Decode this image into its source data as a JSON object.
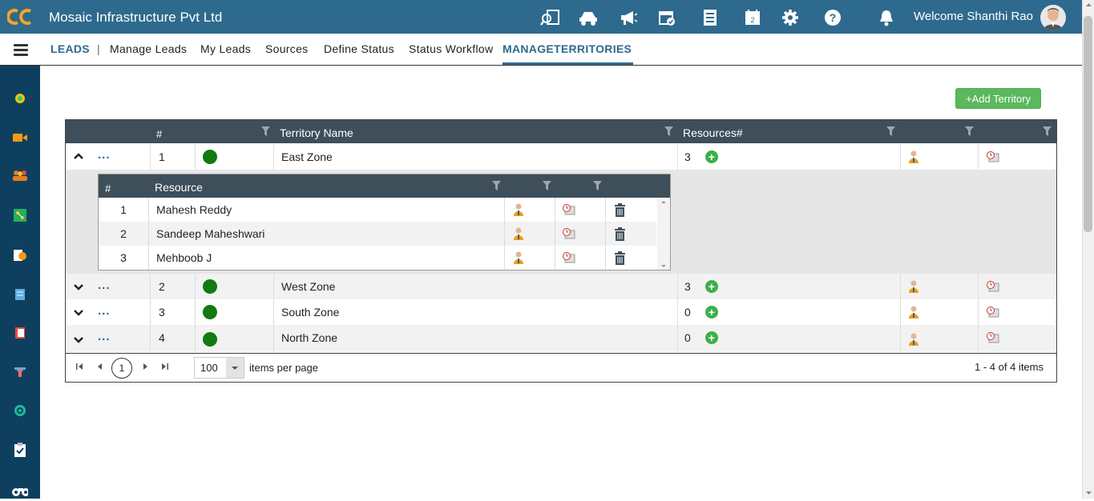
{
  "header": {
    "company": "Mosaic Infrastructure Pvt Ltd",
    "welcome": "Welcome Shanthi Rao",
    "icons": [
      "search-report-icon",
      "truck-icon",
      "megaphone-icon",
      "calendar-check-icon",
      "document-list-icon",
      "calendar-icon",
      "gear-icon",
      "help-icon",
      "bell-icon"
    ]
  },
  "nav": {
    "leads": "LEADS",
    "sep": "|",
    "items": [
      "Manage Leads",
      "My Leads",
      "Sources",
      "Define Status",
      "Status Workflow"
    ],
    "active": "MANAGETERRITORIES"
  },
  "sidebar": {
    "icons": [
      "dashboard-icon",
      "video-icon",
      "people-icon",
      "network-icon",
      "pie-chart-icon",
      "notepad-icon",
      "book-icon",
      "funnel-icon",
      "target-icon",
      "clipboard-check-icon",
      "binoculars-icon"
    ]
  },
  "add_button": "+Add Territory",
  "grid": {
    "headers": {
      "num": "#",
      "name": "Territory Name",
      "resources": "Resources#"
    },
    "rows": [
      {
        "num": "1",
        "name": "East Zone",
        "resources": "3",
        "expanded": true
      },
      {
        "num": "2",
        "name": "West Zone",
        "resources": "3",
        "expanded": false
      },
      {
        "num": "3",
        "name": "South Zone",
        "resources": "0",
        "expanded": false
      },
      {
        "num": "4",
        "name": "North Zone",
        "resources": "0",
        "expanded": false
      }
    ],
    "status_color": "#117a11",
    "more_label": "...",
    "sub": {
      "headers": {
        "num": "#",
        "resource": "Resource"
      },
      "rows": [
        {
          "num": "1",
          "name": "Mahesh Reddy"
        },
        {
          "num": "2",
          "name": "Sandeep Maheshwari"
        },
        {
          "num": "3",
          "name": "Mehboob J"
        }
      ]
    },
    "pager": {
      "page": "1",
      "page_size": "100",
      "page_size_label": "items per page",
      "info": "1 - 4 of 4 items"
    }
  }
}
